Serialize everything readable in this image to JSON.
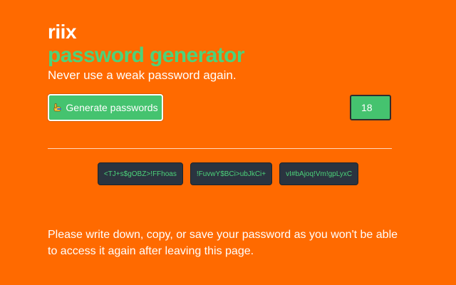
{
  "header": {
    "brand": "riix",
    "title": "password generator",
    "tagline": "Never use a weak password again."
  },
  "controls": {
    "generate_label": "Generate passwords",
    "generate_icon": "hand-pointing-icon",
    "length_value": "18"
  },
  "passwords": [
    "<TJ+s$gOBZ>!FFhoas",
    "!FuvwY$BCi>ubJkCi+",
    "vI#bAjoq!Vm!gpLyxC"
  ],
  "footer": {
    "note": "Please write down, copy, or save your password as you won't be able to access it again after leaving this page."
  },
  "colors": {
    "background": "#ff6a00",
    "accent_green": "#4cd37a",
    "button_green": "#45c36f",
    "chip_dark": "#2b3440"
  }
}
